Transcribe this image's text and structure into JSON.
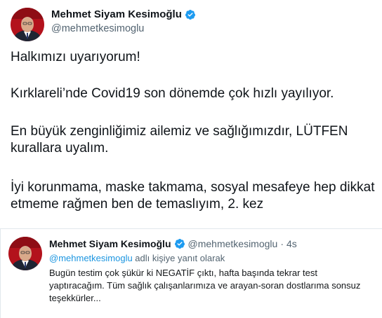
{
  "tweet": {
    "author": {
      "display_name": "Mehmet Siyam Kesimoğlu",
      "handle": "@mehmetkesimoglu",
      "avatar_icon": "profile-photo",
      "verified_icon": "verified-badge-icon"
    },
    "paragraphs": [
      "Halkımızı uyarıyorum!",
      "Kırklareli’nde Covid19 son dönemde çok hızlı yayılıyor.",
      "En büyük zenginliğimiz ailemiz ve sağlığımızdır, LÜTFEN kurallara uyalım.",
      "İyi korunmama, maske takmama, sosyal mesafeye hep dikkat etmeme rağmen ben de temaslıyım, 2. kez"
    ]
  },
  "reply": {
    "author": {
      "display_name": "Mehmet Siyam Kesimoğlu",
      "handle": "@mehmetkesimoglu",
      "separator": "·",
      "time": "4s"
    },
    "reply_to_mention": "@mehmetkesimoglu",
    "reply_to_suffix": " adlı kişiye yanıt olarak",
    "text": "Bugün testim çok şükür ki NEGATİF çıktı, hafta başında tekrar test yaptıracağım. Tüm sağlık çalışanlarımıza ve arayan-soran dostlarıma sonsuz teşekkürler..."
  },
  "colors": {
    "verified_blue": "#1d9bf0",
    "link_blue": "#1b95e0",
    "secondary_text": "#536471"
  }
}
